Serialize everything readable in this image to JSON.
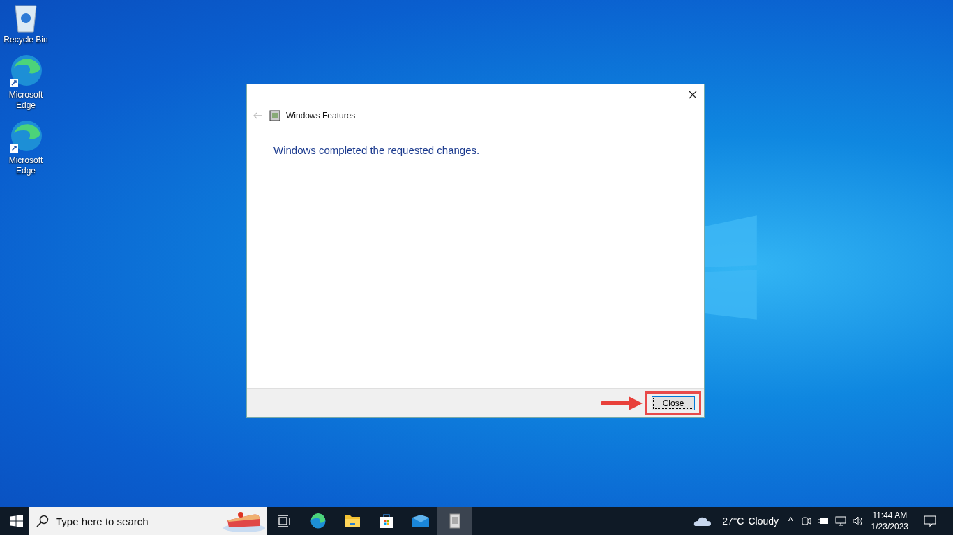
{
  "desktop_icons": [
    {
      "kind": "recycle",
      "label": "Recycle Bin"
    },
    {
      "kind": "edge",
      "label": "Microsoft Edge"
    },
    {
      "kind": "edge",
      "label": "Microsoft Edge"
    }
  ],
  "dialog": {
    "title": "Windows Features",
    "message": "Windows completed the requested changes.",
    "close_button": "Close",
    "back_disabled": true
  },
  "taskbar": {
    "search": {
      "placeholder": "Type here to search"
    },
    "apps": [
      {
        "kind": "taskview",
        "selected": false
      },
      {
        "kind": "edge",
        "selected": false
      },
      {
        "kind": "folder",
        "selected": false
      },
      {
        "kind": "store",
        "selected": false
      },
      {
        "kind": "mail",
        "selected": false
      },
      {
        "kind": "features",
        "selected": true
      }
    ],
    "weather": {
      "temperature": "27°C",
      "condition": "Cloudy"
    },
    "tray_chevron": "^",
    "time": "11:44 AM",
    "date": "1/23/2023"
  }
}
